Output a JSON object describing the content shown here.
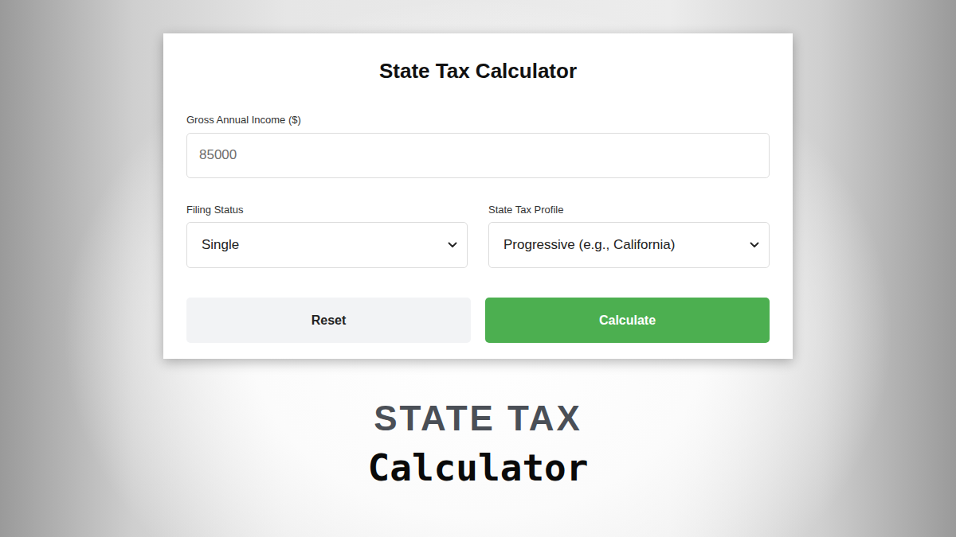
{
  "card": {
    "title": "State Tax Calculator"
  },
  "income": {
    "label": "Gross Annual Income ($)",
    "value": "85000"
  },
  "selects": [
    {
      "label": "Filing Status",
      "value": "Single"
    },
    {
      "label": "State Tax Profile",
      "value": "Progressive (e.g., California)"
    }
  ],
  "buttons": [
    {
      "label": "Reset",
      "kind": "secondary"
    },
    {
      "label": "Calculate",
      "kind": "primary"
    }
  ],
  "caption": {
    "headline": "STATE TAX",
    "subline": "Calculator"
  }
}
